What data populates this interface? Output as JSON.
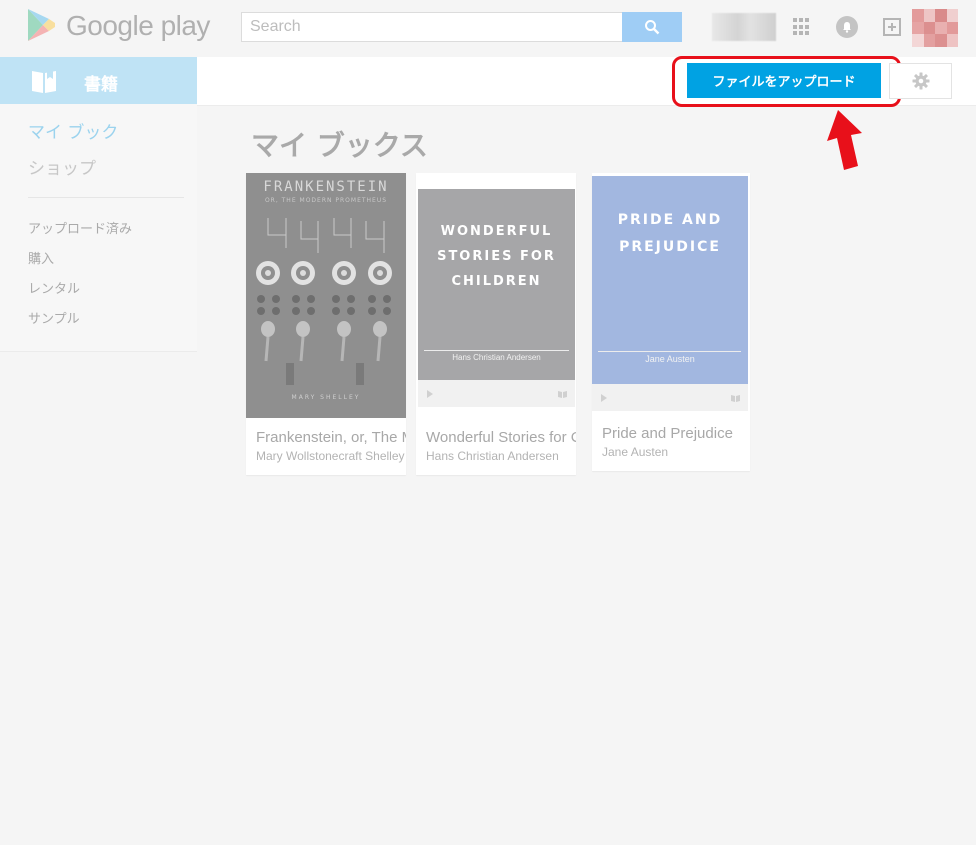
{
  "header": {
    "logo_text": "Google play",
    "search_placeholder": "Search"
  },
  "sidebar": {
    "section_title": "書籍",
    "primary": [
      {
        "label": "マイ ブック"
      },
      {
        "label": "ショップ"
      }
    ],
    "secondary": [
      {
        "label": "アップロード済み"
      },
      {
        "label": "購入"
      },
      {
        "label": "レンタル"
      },
      {
        "label": "サンプル"
      }
    ]
  },
  "toolbar": {
    "upload_label": "ファイルをアップロード"
  },
  "main": {
    "title": "マイ ブックス",
    "books": [
      {
        "title": "Frankenstein, or, The Modern Prometheus",
        "author": "Mary Wollstonecraft Shelley",
        "cover_title": "FRANKENSTEIN",
        "cover_subtitle": "OR, THE MODERN PROMETHEUS",
        "cover_author": "MARY SHELLEY"
      },
      {
        "title": "Wonderful Stories for Children",
        "author": "Hans Christian Andersen",
        "cover_title": "WONDERFUL STORIES FOR CHILDREN",
        "cover_author": "Hans Christian Andersen"
      },
      {
        "title": "Pride and Prejudice",
        "author": "Jane Austen",
        "cover_title": "PRIDE AND PREJUDICE",
        "cover_author": "Jane Austen"
      }
    ]
  },
  "colors": {
    "accent": "#00a2e3",
    "highlight": "#e8101a",
    "sidebar_header": "#bfe3f5"
  }
}
